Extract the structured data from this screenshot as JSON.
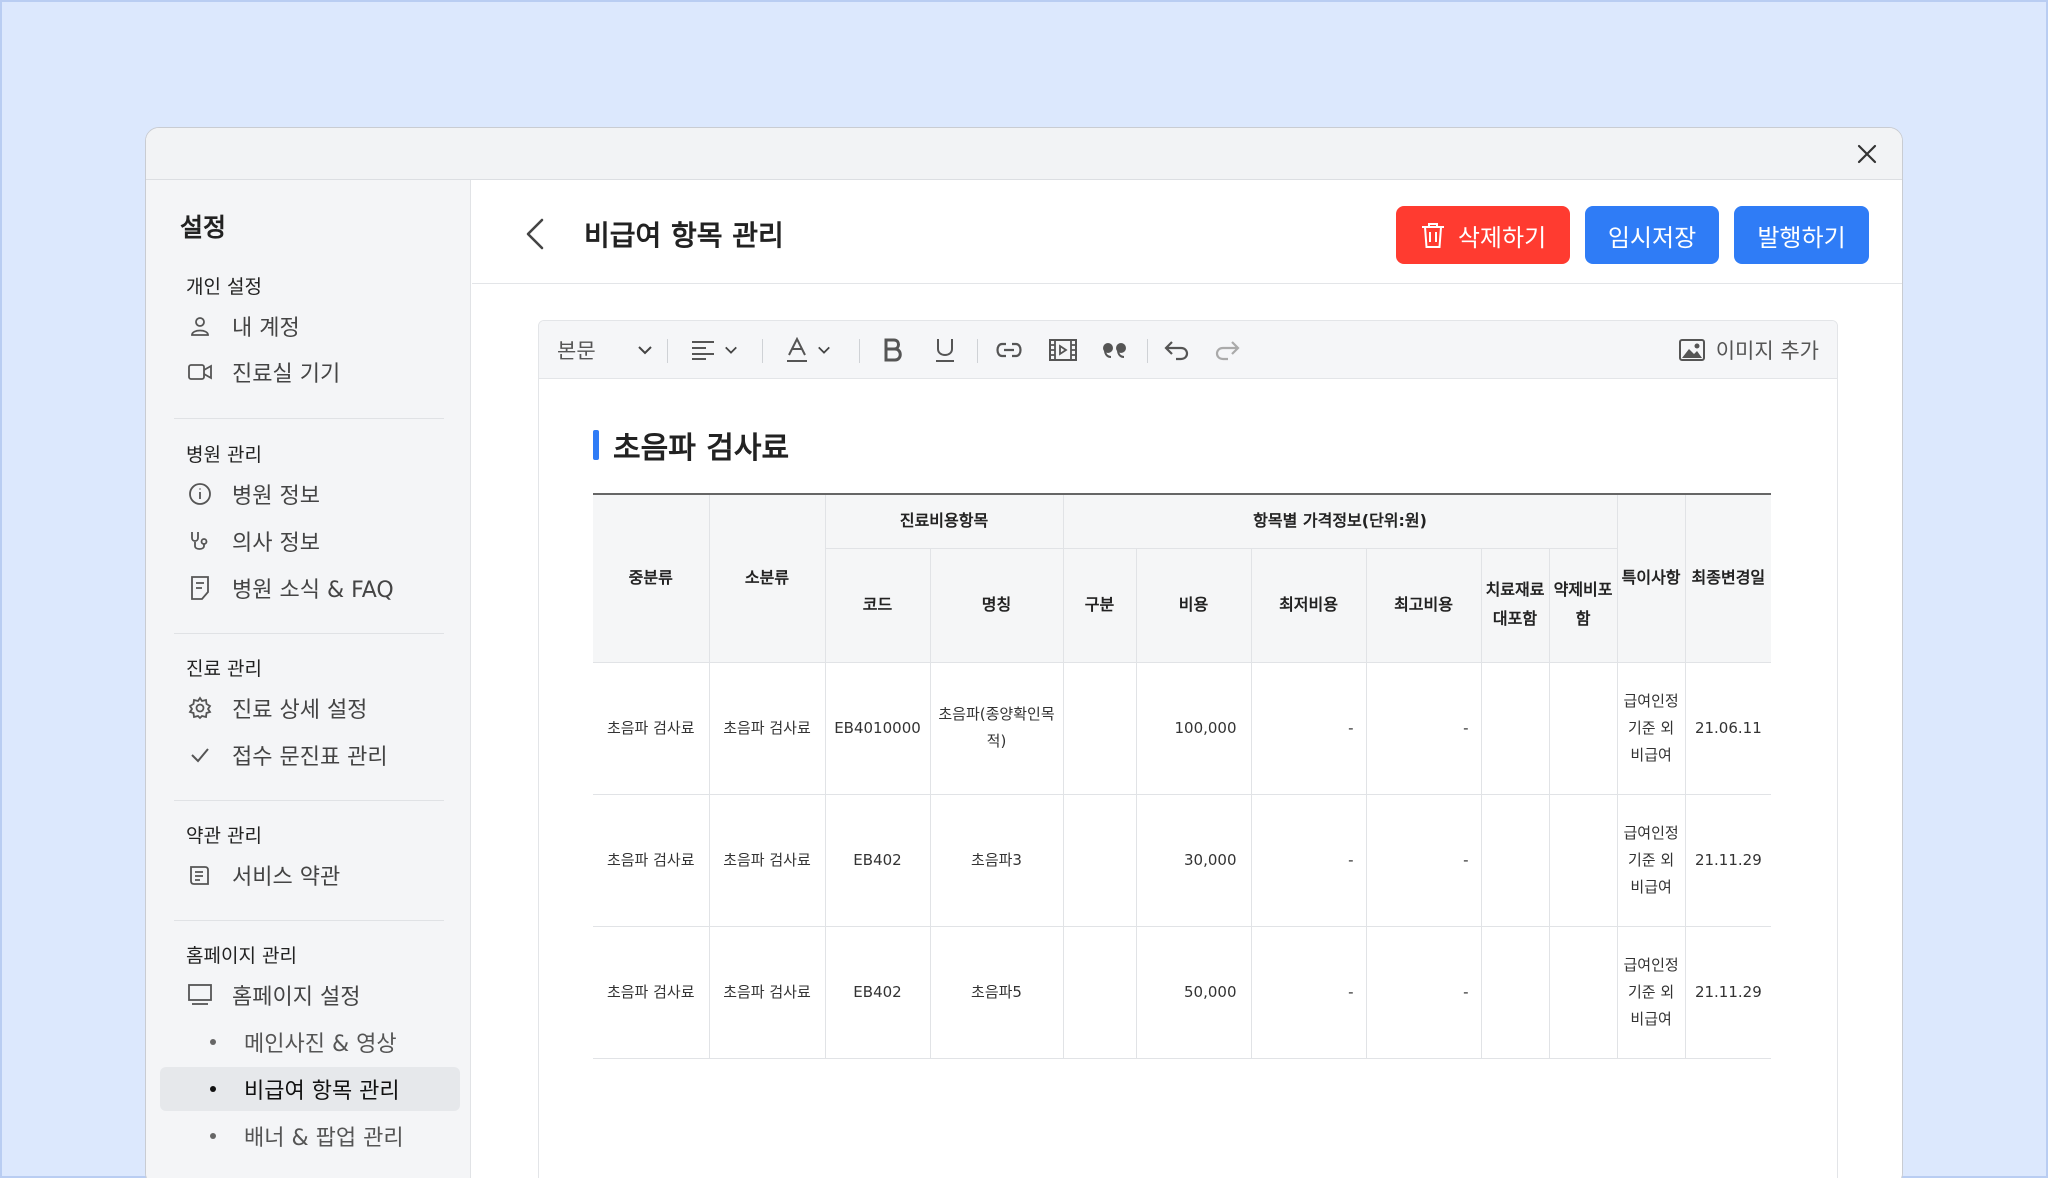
{
  "sidebar": {
    "title": "설정",
    "sections": [
      {
        "title": "개인 설정",
        "items": [
          {
            "label": "내 계정",
            "icon": "user-icon"
          },
          {
            "label": "진료실 기기",
            "icon": "video-camera-icon"
          }
        ]
      },
      {
        "title": "병원 관리",
        "items": [
          {
            "label": "병원 정보",
            "icon": "info-icon"
          },
          {
            "label": "의사 정보",
            "icon": "stethoscope-icon"
          },
          {
            "label": "병원 소식 & FAQ",
            "icon": "document-icon"
          }
        ]
      },
      {
        "title": "진료 관리",
        "items": [
          {
            "label": "진료 상세 설정",
            "icon": "gear-icon"
          },
          {
            "label": "접수 문진표 관리",
            "icon": "check-icon"
          }
        ]
      },
      {
        "title": "약관 관리",
        "items": [
          {
            "label": "서비스 약관",
            "icon": "book-icon"
          }
        ]
      },
      {
        "title": "홈페이지 관리",
        "items": [
          {
            "label": "홈페이지 설정",
            "icon": "monitor-icon"
          }
        ]
      }
    ],
    "subitems": [
      "메인사진 & 영상",
      "비급여 항목 관리",
      "배너 & 팝업 관리"
    ],
    "active_subitem": "비급여 항목 관리"
  },
  "header": {
    "title": "비급여 항목 관리",
    "delete_label": "삭제하기",
    "draft_label": "임시저장",
    "publish_label": "발행하기"
  },
  "toolbar": {
    "style_select": "본문",
    "image_add_label": "이미지 추가"
  },
  "document": {
    "heading": "초음파 검사료",
    "table": {
      "headers": {
        "mid_category": "중분류",
        "sub_category": "소분류",
        "group_items": "진료비용항목",
        "group_price": "항목별 가격정보(단위:원)",
        "code": "코드",
        "name": "명칭",
        "type": "구분",
        "cost": "비용",
        "min_cost": "최저비용",
        "max_cost": "최고비용",
        "material": "치료재료대포함",
        "drug": "약제비포함",
        "note": "특이사항",
        "updated": "최종변경일"
      },
      "rows": [
        {
          "mid": "초음파 검사료",
          "sub": "초음파 검사료",
          "code": "EB4010000",
          "name": "초음파(종양확인목적)",
          "type": "",
          "cost": "100,000",
          "min": "-",
          "max": "-",
          "material": "",
          "drug": "",
          "note": "급여인정 기준 외 비급여",
          "updated": "21.06.11"
        },
        {
          "mid": "초음파 검사료",
          "sub": "초음파 검사료",
          "code": "EB402",
          "name": "초음파3",
          "type": "",
          "cost": "30,000",
          "min": "-",
          "max": "-",
          "material": "",
          "drug": "",
          "note": "급여인정 기준 외 비급여",
          "updated": "21.11.29"
        },
        {
          "mid": "초음파 검사료",
          "sub": "초음파 검사료",
          "code": "EB402",
          "name": "초음파5",
          "type": "",
          "cost": "50,000",
          "min": "-",
          "max": "-",
          "material": "",
          "drug": "",
          "note": "급여인정 기준 외 비급여",
          "updated": "21.11.29"
        }
      ]
    }
  },
  "colors": {
    "page_bg": "#dce8fd",
    "accent_blue": "#2f7cf6",
    "danger_red": "#ff3b30"
  }
}
